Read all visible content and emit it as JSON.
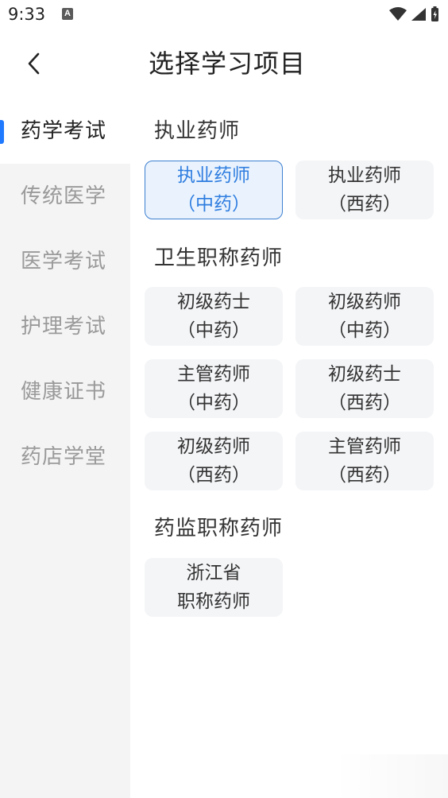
{
  "status": {
    "time": "9:33",
    "a_icon_letter": "A"
  },
  "header": {
    "title": "选择学习项目"
  },
  "sidebar": {
    "items": [
      {
        "label": "药学考试",
        "active": true
      },
      {
        "label": "传统医学"
      },
      {
        "label": "医学考试"
      },
      {
        "label": "护理考试"
      },
      {
        "label": "健康证书"
      },
      {
        "label": "药店学堂"
      }
    ]
  },
  "sections": [
    {
      "title": "执业药师",
      "cards": [
        {
          "line1": "执业药师",
          "line2": "（中药）",
          "selected": true
        },
        {
          "line1": "执业药师",
          "line2": "（西药）"
        }
      ]
    },
    {
      "title": "卫生职称药师",
      "cards": [
        {
          "line1": "初级药士",
          "line2": "（中药）"
        },
        {
          "line1": "初级药师",
          "line2": "（中药）"
        },
        {
          "line1": "主管药师",
          "line2": "（中药）"
        },
        {
          "line1": "初级药士",
          "line2": "（西药）"
        },
        {
          "line1": "初级药师",
          "line2": "（西药）"
        },
        {
          "line1": "主管药师",
          "line2": "（西药）"
        }
      ]
    },
    {
      "title": "药监职称药师",
      "cards": [
        {
          "line1": "浙江省",
          "line2": "职称药师"
        }
      ]
    }
  ],
  "colors": {
    "accent": "#1f7aff",
    "selected_border": "#3c7fd0",
    "selected_text": "#2f7de0",
    "sidebar_bg": "#f4f4f5",
    "card_bg": "#f4f5f7"
  }
}
